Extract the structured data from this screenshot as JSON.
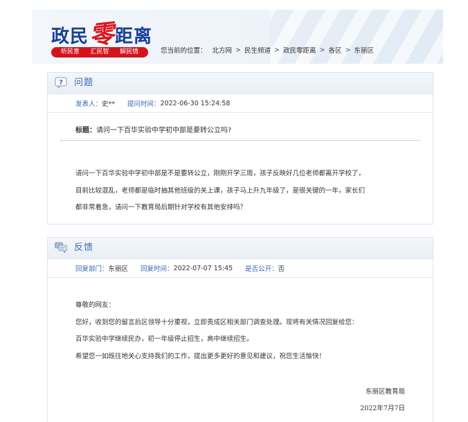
{
  "header": {
    "logo_part1": "政民",
    "logo_zero": "零",
    "logo_part2": "距离",
    "slogans": [
      "听民意",
      "汇民智",
      "解民情"
    ],
    "breadcrumb_label": "您当前的位置：",
    "breadcrumb": [
      "北方网",
      "民生频道",
      "政民零距离",
      "各区",
      "东丽区"
    ],
    "breadcrumb_sep": ">"
  },
  "question": {
    "section_title": "问题",
    "author_label": "发表人：",
    "author": "史**",
    "time_label": "提问时间：",
    "time": "2022-06-30 15:24:58",
    "title_label": "标题：",
    "title": "请问一下百华实验中学初中部是要转公立吗?",
    "body_lines": [
      "请问一下百华实验中学初中部是不是要转公立，刚刚开学三周，孩子反映好几位老师都离开学校了，",
      "目前比较混乱，老师都是临时抽其他班级的关上课，孩子马上升九年级了，是很关键的一年，家长们",
      "都非常着急，请问一下教育局后期针对学校有其他安排吗？"
    ]
  },
  "reply": {
    "section_title": "反馈",
    "dept_label": "回复部门：",
    "dept": "东丽区",
    "time_label": "回复时间：",
    "time": "2022-07-07 15:45",
    "public_label": "是否公开：",
    "public": "否",
    "body_lines": [
      "尊敬的网友：",
      "您好，收到您的留言后区领导十分重视，立即责成区相关部门调查处理。现将有关情况回复给您：",
      "百华实验中学继续民办，初一年级停止招生，高中继续招生。",
      "希望您一如既往地关心支持我们的工作，提出更多更好的意见和建议，祝您生活愉快！"
    ],
    "signature": "东丽区教育局",
    "date": "2022年7月7日"
  },
  "colors": {
    "brand_blue": "#173f9a",
    "brand_red": "#d9161c",
    "link_blue": "#3a67b5"
  }
}
